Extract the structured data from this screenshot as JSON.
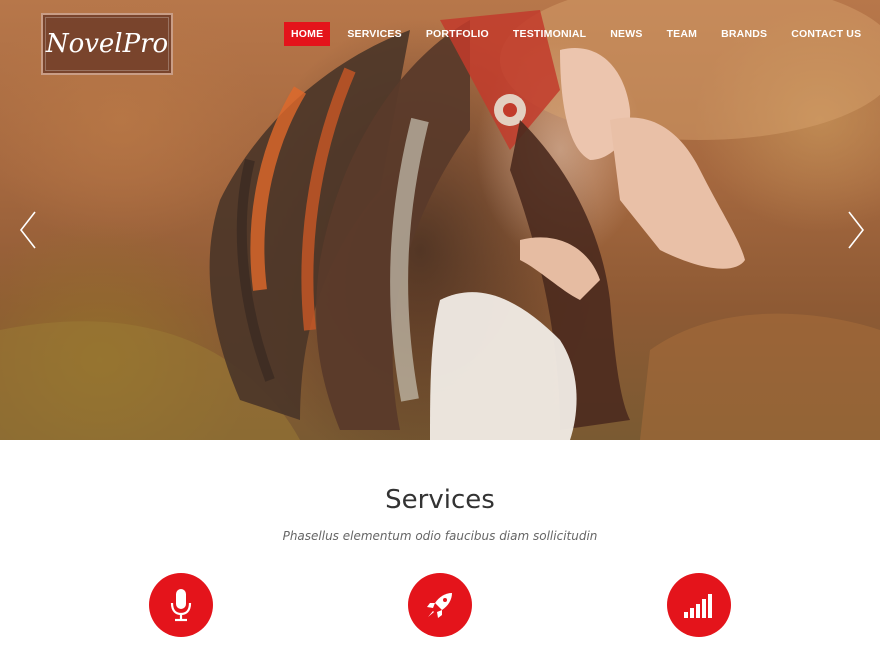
{
  "brand": {
    "logo_text": "NovelPro"
  },
  "nav": {
    "items": [
      {
        "label": "HOME",
        "active": true
      },
      {
        "label": "SERVICES",
        "active": false
      },
      {
        "label": "PORTFOLIO",
        "active": false
      },
      {
        "label": "TESTIMONIAL",
        "active": false
      },
      {
        "label": "NEWS",
        "active": false
      },
      {
        "label": "TEAM",
        "active": false
      },
      {
        "label": "BRANDS",
        "active": false
      },
      {
        "label": "CONTACT US",
        "active": false
      }
    ]
  },
  "hero": {
    "prev_icon": "chevron-left-icon",
    "next_icon": "chevron-right-icon"
  },
  "services": {
    "title": "Services",
    "subtitle": "Phasellus elementum odio faucibus diam sollicitudin",
    "icons": [
      "microphone-icon",
      "rocket-icon",
      "signal-bars-icon"
    ]
  },
  "colors": {
    "accent": "#e4141b"
  }
}
